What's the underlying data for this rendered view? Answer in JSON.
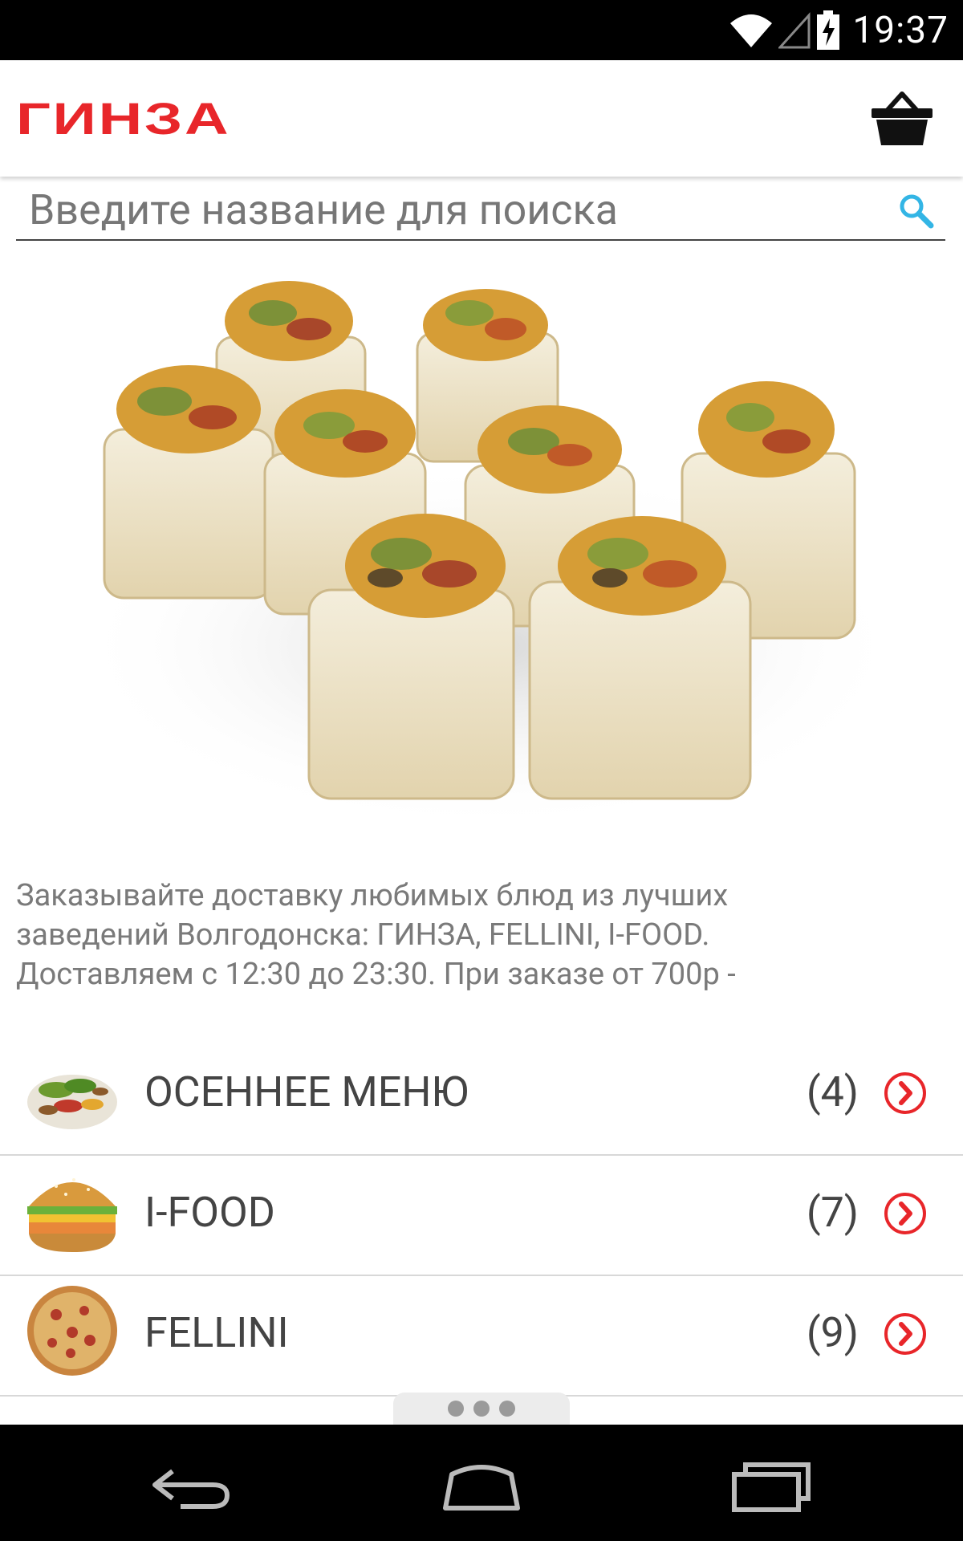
{
  "status_bar": {
    "time": "19:37"
  },
  "app_bar": {
    "title": "ГИНЗА"
  },
  "search": {
    "placeholder": "Введите название для поиска"
  },
  "description": {
    "line1": "Заказывайте доставку любимых блюд из лучших",
    "line2": "заведений Волгодонска: ГИНЗА, FELLINI, I-FOOD.",
    "line3": "Доставляем с 12:30 до 23:30. При заказе от 700р -"
  },
  "categories": [
    {
      "label": "ОСЕННЕЕ МЕНЮ",
      "count": "(4)",
      "thumb": "salad"
    },
    {
      "label": "I-FOOD",
      "count": "(7)",
      "thumb": "burger"
    },
    {
      "label": "FELLINI",
      "count": "(9)",
      "thumb": "pizza"
    }
  ],
  "colors": {
    "accent": "#e8262a",
    "search_icon": "#33b5e5"
  }
}
